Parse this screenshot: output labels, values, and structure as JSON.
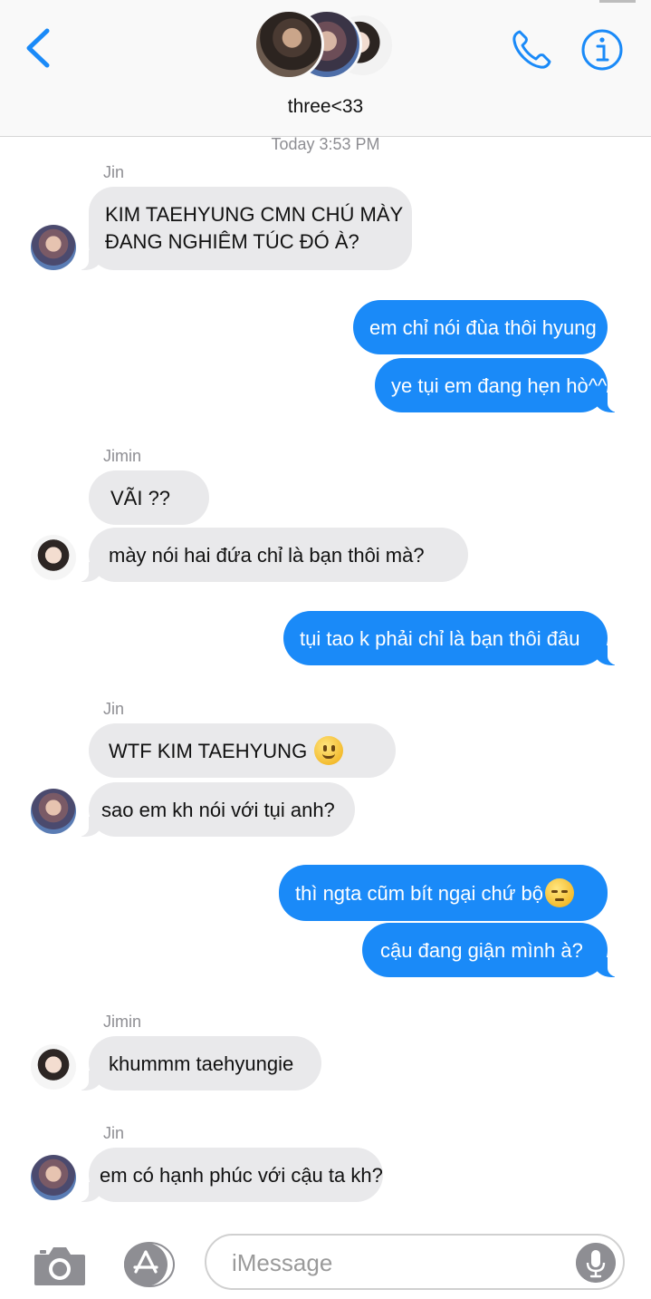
{
  "header": {
    "group_name": "three<33"
  },
  "timestamp": "Today 3:53 PM",
  "messages": [
    {
      "sender": "Jin",
      "text": "KIM TAEHYUNG CMN CHÚ MÀY"
    },
    {
      "text": "ĐANG NGHIÊM TÚC ĐÓ À?"
    },
    {
      "text": "em chỉ nói đùa thôi hyung"
    },
    {
      "text": "ye tụi em đang hẹn hò^^"
    },
    {
      "sender": "Jimin",
      "text": "VÃI ??"
    },
    {
      "text": "mày nói hai đứa chỉ là bạn thôi mà?"
    },
    {
      "text": "tụi tao k phải chỉ là bạn thôi đâu"
    },
    {
      "sender": "Jin",
      "text": "WTF KIM TAEHYUNG",
      "emoji": "slightly-smiling-face"
    },
    {
      "text": "sao em kh nói với tụi anh?"
    },
    {
      "text": "thì ngta cũm bít ngại chứ bộ",
      "emoji": "pensive-face"
    },
    {
      "text": "cậu đang giận mình à?"
    },
    {
      "sender": "Jimin",
      "text": "khummm taehyungie"
    },
    {
      "sender": "Jin",
      "text": "em có hạnh phúc với cậu ta kh?"
    }
  ],
  "composer": {
    "placeholder": "iMessage"
  },
  "icons": {
    "back": "chevron-left-icon",
    "call": "phone-icon",
    "info": "info-icon",
    "camera": "camera-icon",
    "apps": "app-store-icon",
    "mic": "microphone-icon"
  },
  "colors": {
    "accent": "#1a8af8",
    "incoming_bubble": "#e9e9eb",
    "meta_text": "#8e8e93"
  }
}
